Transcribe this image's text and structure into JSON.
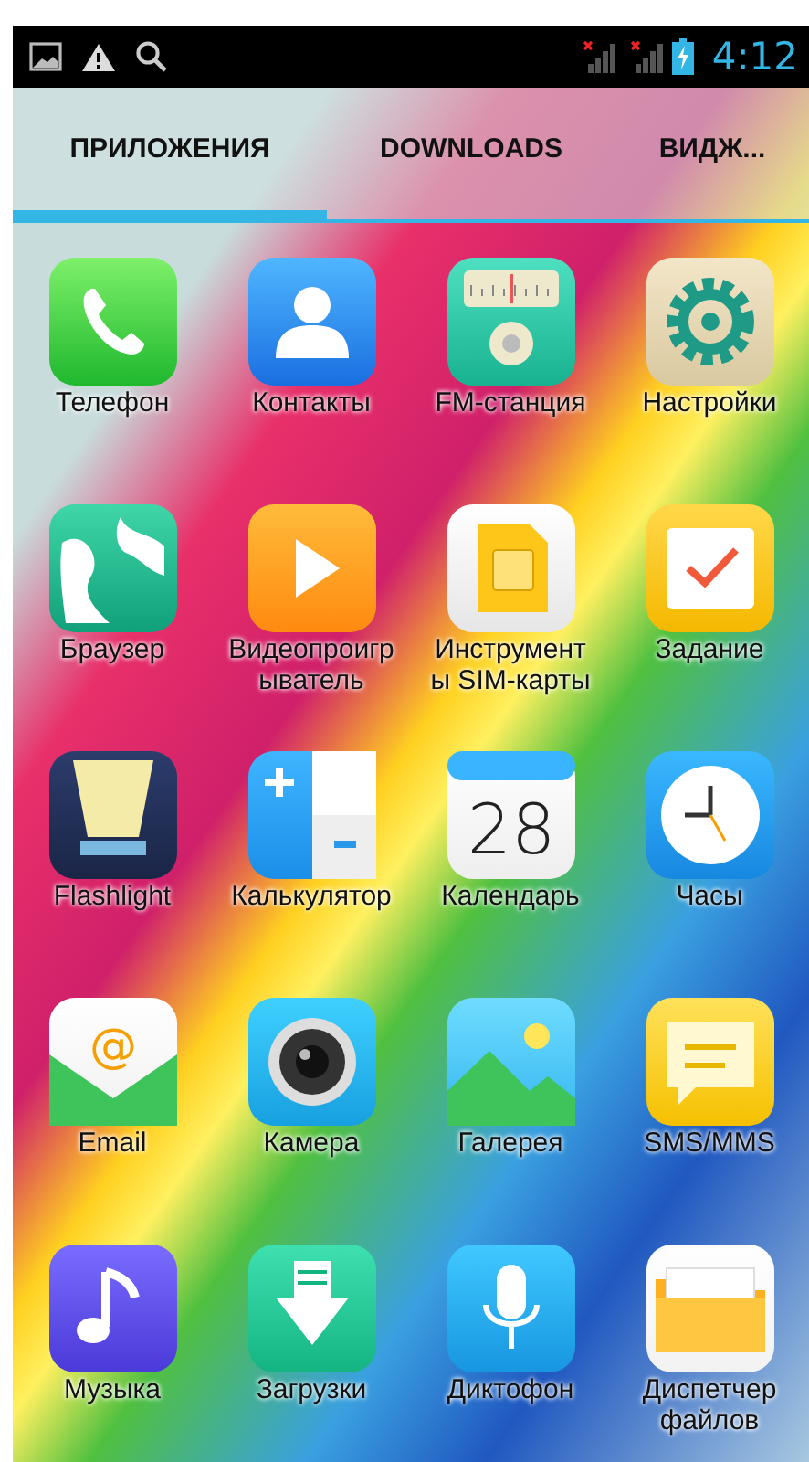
{
  "status_bar": {
    "time": "4:12"
  },
  "tabs": [
    {
      "label": "ПРИЛОЖЕНИЯ",
      "selected": true
    },
    {
      "label": "DOWNLOADS",
      "selected": false
    },
    {
      "label": "ВИДЖ...",
      "selected": false
    }
  ],
  "apps": [
    {
      "kind": "phone",
      "label_lines": [
        "Телефон"
      ]
    },
    {
      "kind": "contacts",
      "label_lines": [
        "Контакты"
      ]
    },
    {
      "kind": "radio",
      "label_lines": [
        "FM-станция"
      ]
    },
    {
      "kind": "settings",
      "label_lines": [
        "Настройки"
      ]
    },
    {
      "kind": "browser",
      "label_lines": [
        "Браузер"
      ]
    },
    {
      "kind": "video",
      "label_lines": [
        "Видеопроигр",
        "ыватель"
      ]
    },
    {
      "kind": "sim",
      "label_lines": [
        "Инструмент",
        "ы SIM-карты"
      ]
    },
    {
      "kind": "tasks",
      "label_lines": [
        "Задание"
      ]
    },
    {
      "kind": "flashlight",
      "label_lines": [
        "Flashlight"
      ]
    },
    {
      "kind": "calculator",
      "label_lines": [
        "Калькулятор"
      ]
    },
    {
      "kind": "calendar",
      "icon_text": "28",
      "label_lines": [
        "Календарь"
      ]
    },
    {
      "kind": "clock",
      "label_lines": [
        "Часы"
      ]
    },
    {
      "kind": "email",
      "icon_text": "@",
      "label_lines": [
        "Email"
      ]
    },
    {
      "kind": "camera",
      "label_lines": [
        "Камера"
      ]
    },
    {
      "kind": "gallery",
      "label_lines": [
        "Галерея"
      ]
    },
    {
      "kind": "sms",
      "label_lines": [
        "SMS/MMS"
      ]
    },
    {
      "kind": "music",
      "label_lines": [
        "Музыка"
      ]
    },
    {
      "kind": "downloads",
      "label_lines": [
        "Загрузки"
      ]
    },
    {
      "kind": "recorder",
      "label_lines": [
        "Диктофон"
      ]
    },
    {
      "kind": "files",
      "label_lines": [
        "Диспетчер",
        "файлов"
      ]
    }
  ]
}
